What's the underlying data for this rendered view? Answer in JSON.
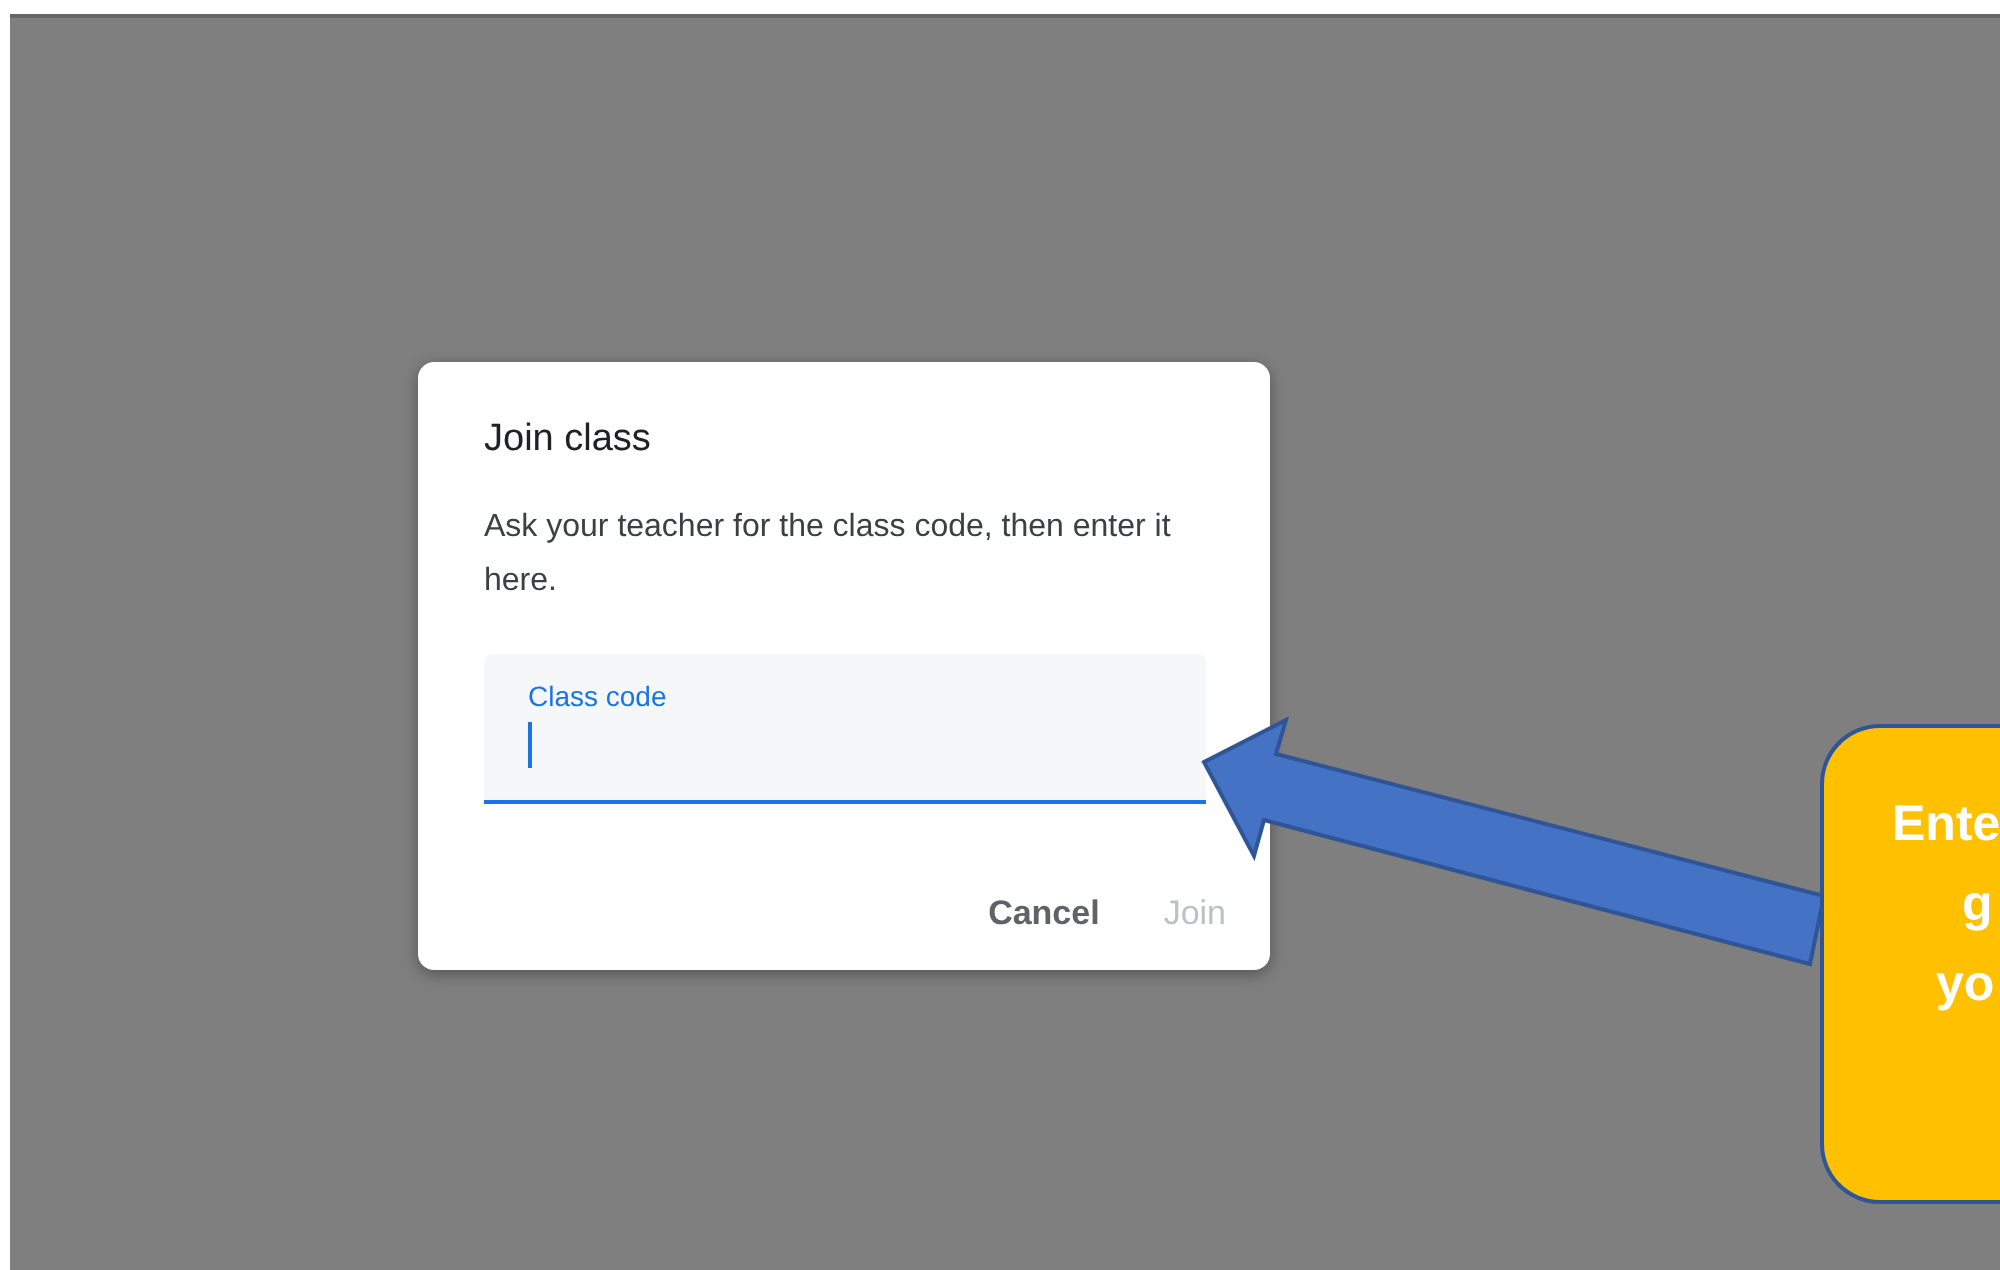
{
  "dialog": {
    "title": "Join class",
    "description": "Ask your teacher for the class code, then enter it here.",
    "field": {
      "label": "Class code",
      "focused": true
    },
    "buttons": [
      {
        "label": "Cancel",
        "disabled": false
      },
      {
        "label": "Join",
        "disabled": true
      }
    ]
  },
  "callout": {
    "lines": [
      "Ente",
      "g",
      "yo"
    ]
  }
}
